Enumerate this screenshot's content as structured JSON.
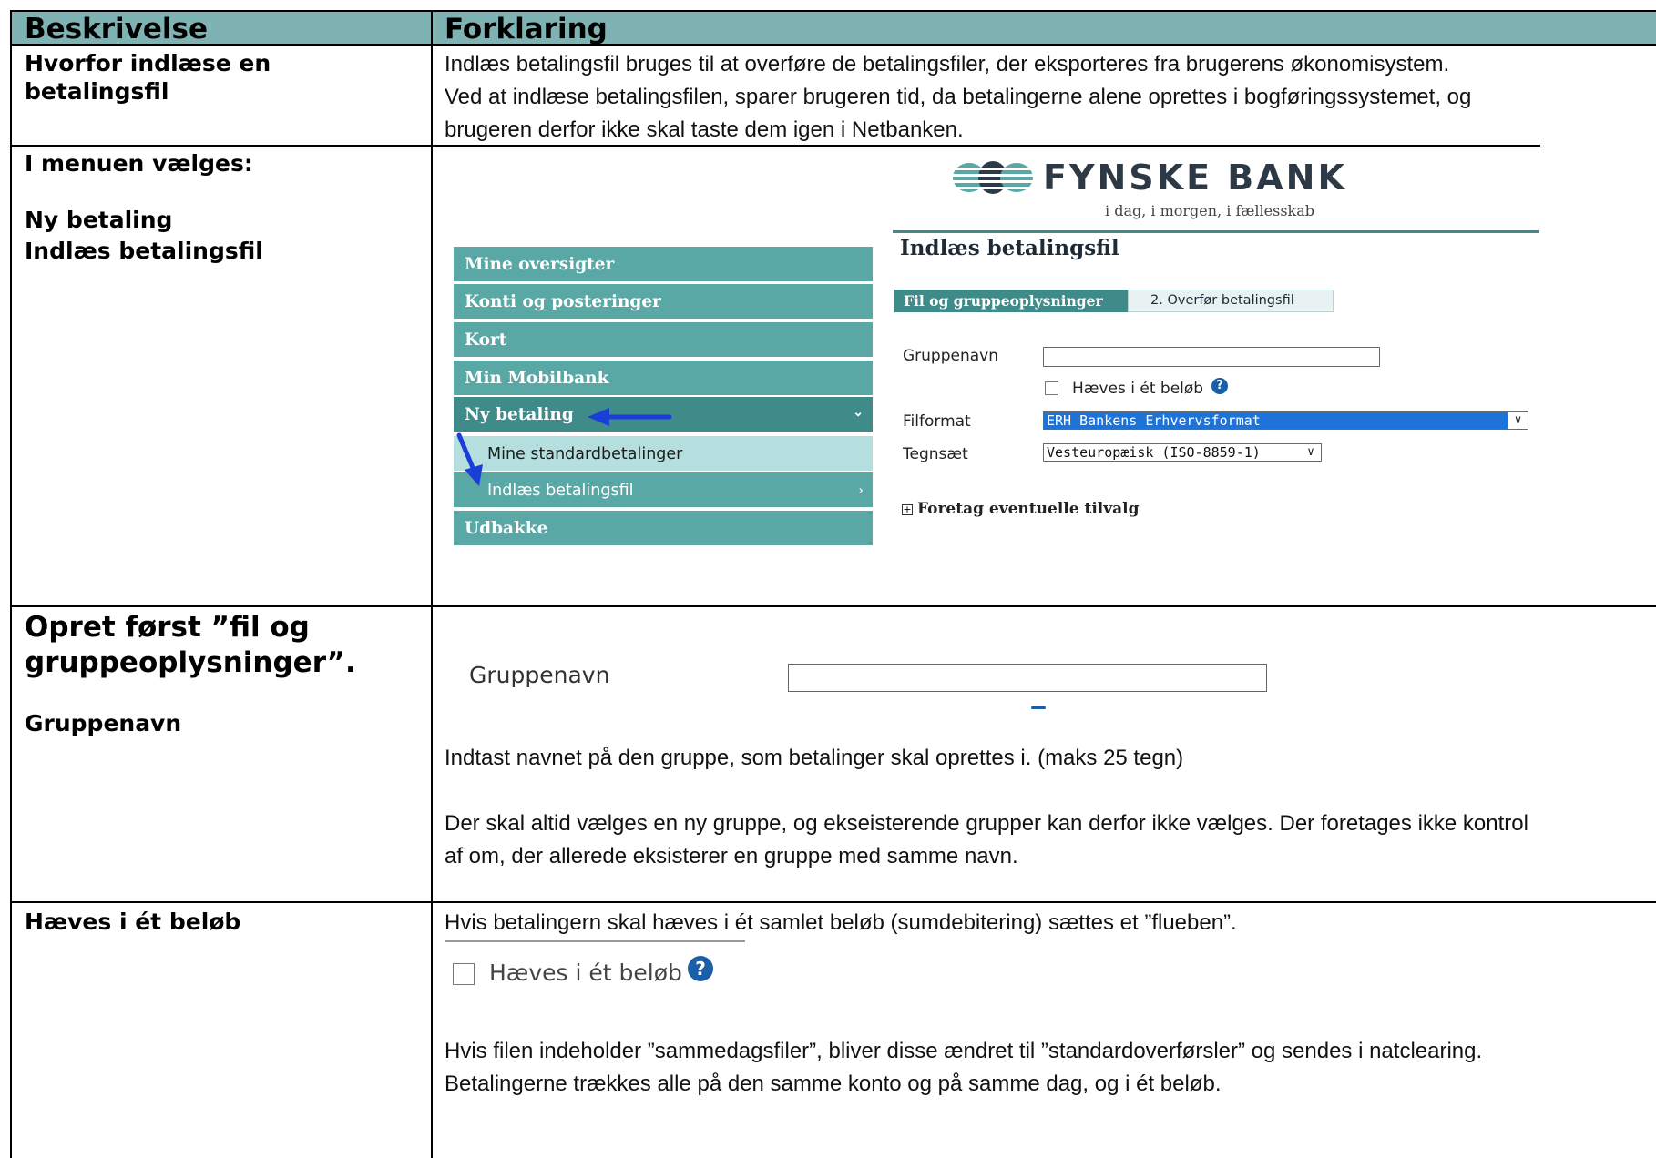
{
  "header": {
    "col1": "Beskrivelse",
    "col2": "Forklaring"
  },
  "row1": {
    "label_line1": "Hvorfor indlæse en",
    "label_line2": "betalingsfil",
    "text_line1": "Indlæs betalingsfil bruges til at overføre de betalingsfiler, der eksporteres fra brugerens økonomisystem.",
    "text_line2": "Ved at indlæse betalingsfilen, sparer brugeren tid, da betalingerne alene oprettes i bogføringssystemet, og",
    "text_line3": "brugeren derfor ikke skal taste dem igen i Netbanken."
  },
  "row2": {
    "label_line1": "I menuen vælges:",
    "label_line2": "Ny betaling",
    "label_line3": "Indlæs betalingsfil"
  },
  "netbank": {
    "logo_text": "FYNSKE BANK",
    "logo_tagline": "i dag, i morgen, i fællesskab",
    "menu": [
      {
        "label": "Mine oversigter"
      },
      {
        "label": "Konti og posteringer"
      },
      {
        "label": "Kort"
      },
      {
        "label": "Min Mobilbank"
      },
      {
        "label": "Ny betaling"
      }
    ],
    "submenu": [
      {
        "label": "Mine standardbetalinger"
      },
      {
        "label": "Indlæs betalingsfil"
      }
    ],
    "menu_last": "Udbakke",
    "page_title": "Indlæs betalingsfil",
    "step1": "Fil og gruppeoplysninger",
    "step2": "2. Overfør betalingsfil",
    "group_label": "Gruppenavn",
    "checkbox_label": "Hæves i ét beløb",
    "fileformat_label": "Filformat",
    "fileformat_value": "ERH Bankens Erhvervsformat",
    "charset_label": "Tegnsæt",
    "charset_value": "Vesteuropæisk (ISO-8859-1)",
    "options_label": "Foretag eventuelle tilvalg",
    "colors": {
      "menu": "#5aa8a6",
      "menu_active": "#3f8b89",
      "submenu": "#b5dfde",
      "arrow": "#1a3fd6"
    }
  },
  "row3": {
    "label_line1": "Opret først ”fil og",
    "label_line2": "gruppeoplysninger”.",
    "label_line3": "Gruppenavn",
    "field_label": "Gruppenavn",
    "text_line1": "Indtast navnet på den gruppe, som betalinger skal oprettes i. (maks 25 tegn)",
    "text_line2": "Der skal altid vælges en ny gruppe, og ekseisterende grupper kan derfor ikke vælges. Der foretages ikke kontrol",
    "text_line3": "af om, der allerede eksisterer en gruppe med samme navn."
  },
  "row4": {
    "label": "Hæves i ét beløb",
    "text_line1": "Hvis betalingern skal hæves i ét samlet beløb (sumdebitering) sættes et ”flueben”.",
    "checkbox_label": "Hæves i ét beløb",
    "text_line2": "Hvis filen indeholder ”sammedagsfiler”, bliver disse ændret til ”standardoverførsler” og sendes i natclearing.",
    "text_line3": "Betalingerne trækkes alle på den samme konto og på samme dag, og i ét beløb."
  }
}
